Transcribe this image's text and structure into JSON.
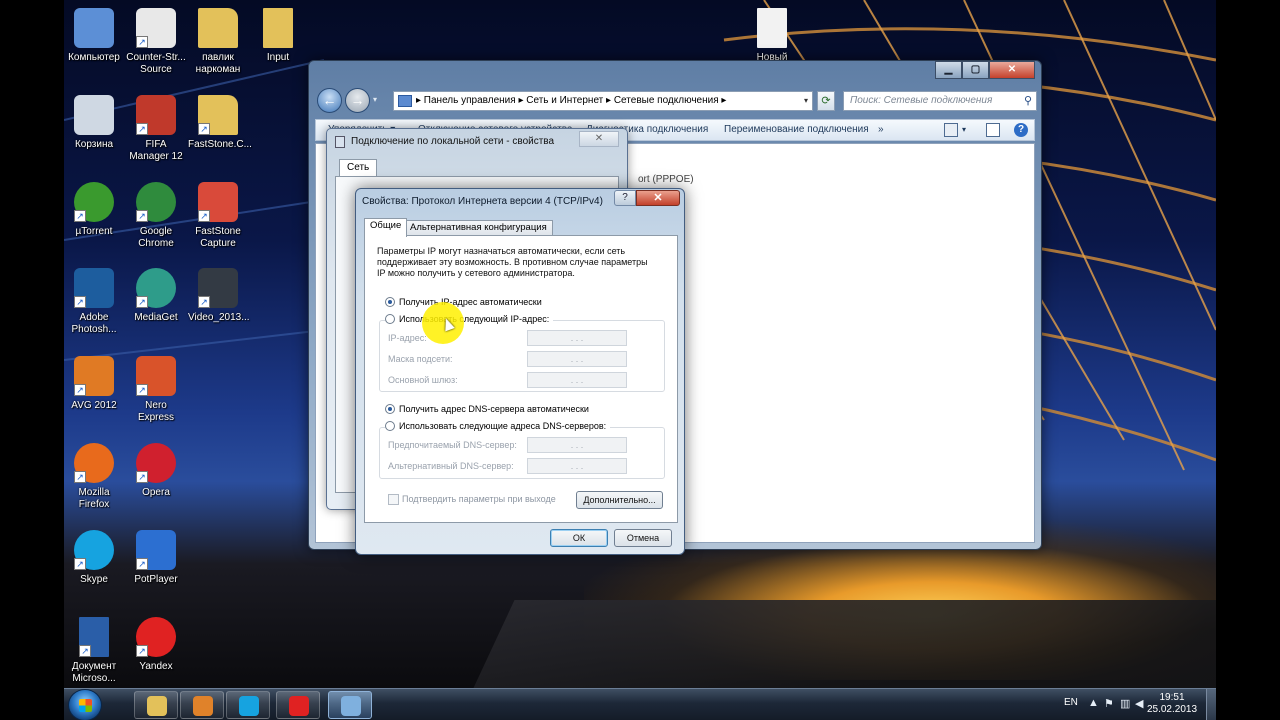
{
  "desktop_icons": [
    {
      "label": "Компьютер",
      "icon": "computer-icon",
      "color": "#5c8fd6"
    },
    {
      "label": "Counter-Str... Source",
      "icon": "counter-strike-icon",
      "color": "#e8e8e8"
    },
    {
      "label": "павлик наркоман",
      "icon": "folder-icon",
      "color": "#e3c15a"
    },
    {
      "label": "Input",
      "icon": "document-icon",
      "color": "#e3c15a"
    },
    {
      "label": "Корзина",
      "icon": "recycle-bin-icon",
      "color": "#cfd8e3"
    },
    {
      "label": "FIFA Manager 12",
      "icon": "fifa-icon",
      "color": "#c0392b"
    },
    {
      "label": "FastStone.C...",
      "icon": "folder-icon",
      "color": "#e3c15a"
    },
    {
      "label": "µTorrent",
      "icon": "utorrent-icon",
      "color": "#3a9a2e"
    },
    {
      "label": "Google Chrome",
      "icon": "chrome-icon",
      "color": "#2f8b3d"
    },
    {
      "label": "FastStone Capture",
      "icon": "faststone-icon",
      "color": "#d94a3a"
    },
    {
      "label": "Adobe Photosh...",
      "icon": "photoshop-icon",
      "color": "#1d5d9e"
    },
    {
      "label": "MediaGet",
      "icon": "mediaget-icon",
      "color": "#2e9c8a"
    },
    {
      "label": "Video_2013...",
      "icon": "video-icon",
      "color": "#333a44"
    },
    {
      "label": "AVG 2012",
      "icon": "avg-icon",
      "color": "#e07a24"
    },
    {
      "label": "Nero Express",
      "icon": "nero-icon",
      "color": "#d9532a"
    },
    {
      "label": "Mozilla Firefox",
      "icon": "firefox-icon",
      "color": "#e86a1c"
    },
    {
      "label": "Opera",
      "icon": "opera-icon",
      "color": "#d0202e"
    },
    {
      "label": "Skype",
      "icon": "skype-icon",
      "color": "#16a3e0"
    },
    {
      "label": "PotPlayer",
      "icon": "potplayer-icon",
      "color": "#2c6fd1"
    },
    {
      "label": "Документ Microso...",
      "icon": "word-doc-icon",
      "color": "#2a5ea8"
    },
    {
      "label": "Yandex",
      "icon": "yandex-icon",
      "color": "#e02222"
    },
    {
      "label": "Новый",
      "icon": "blank-document-icon",
      "color": "#f2f2f2"
    }
  ],
  "explorer": {
    "breadcrumb": "▸ Панель управления ▸ Сеть и Интернет ▸ Сетевые подключения ▸",
    "search_placeholder": "Поиск: Сетевые подключения",
    "commands": [
      "Упорядочить ▾",
      "Отключение сетевого устройства",
      "Диагностика подключения",
      "Переименование подключения",
      "»"
    ],
    "partial_item": "ort (PPPOE)"
  },
  "lan_dialog": {
    "title": "Подключение по локальной сети - свойства",
    "tab": "Сеть"
  },
  "ip_dialog": {
    "title": "Свойства: Протокол Интернета версии 4 (TCP/IPv4)",
    "help": "?",
    "close": "✕",
    "tabs": [
      "Общие",
      "Альтернативная конфигурация"
    ],
    "intro": "Параметры IP могут назначаться автоматически, если сеть поддерживает эту возможность. В противном случае параметры IP можно получить у сетевого администратора.",
    "ip_auto": "Получить IP-адрес автоматически",
    "ip_manual": "Использовать следующий IP-адрес:",
    "ip_label": "IP-адрес:",
    "mask_label": "Маска подсети:",
    "gateway_label": "Основной шлюз:",
    "dns_auto": "Получить адрес DNS-сервера автоматически",
    "dns_manual": "Использовать следующие адреса DNS-серверов:",
    "dns_pref_label": "Предпочитаемый DNS-сервер:",
    "dns_alt_label": "Альтернативный DNS-сервер:",
    "ip_placeholder": ". . .",
    "validate": "Подтвердить параметры при выходе",
    "advanced": "Дополнительно...",
    "ok": "ОК",
    "cancel": "Отмена",
    "ip_mode": "auto",
    "dns_mode": "auto"
  },
  "taskbar": {
    "items": [
      {
        "icon": "explorer-folder-icon",
        "color": "#e3c15a",
        "active": false
      },
      {
        "icon": "media-player-icon",
        "color": "#e0822a",
        "active": false
      },
      {
        "icon": "skype-icon",
        "color": "#16a3e0",
        "active": false
      },
      {
        "icon": "yandex-icon",
        "color": "#e02222",
        "active": false
      },
      {
        "icon": "network-connections-icon",
        "color": "#7fb0de",
        "active": true
      }
    ],
    "language": "EN",
    "time": "19:51",
    "date": "25.02.2013"
  }
}
